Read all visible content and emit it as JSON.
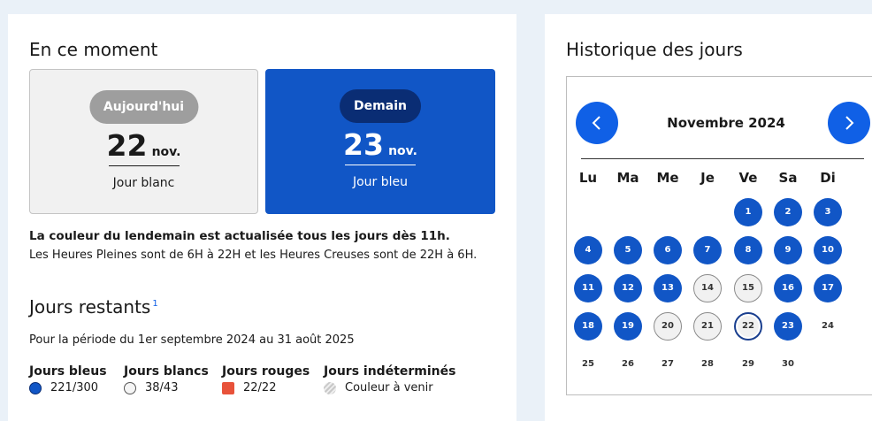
{
  "left": {
    "section_title": "En ce moment",
    "today": {
      "badge": "Aujourd'hui",
      "day": "22",
      "month": "nov.",
      "label": "Jour blanc"
    },
    "tomorrow": {
      "badge": "Demain",
      "day": "23",
      "month": "nov.",
      "label": "Jour bleu"
    },
    "update_note": "La couleur du lendemain est actualisée tous les jours dès 11h.",
    "hours_note": "Les Heures Pleines sont de 6H à 22H et les Heures Creuses sont de 22H à 6H.",
    "remaining_title": "Jours restants",
    "remaining_sup": "1",
    "period": "Pour la période du 1er septembre 2024 au 31 août 2025",
    "legend": [
      {
        "title": "Jours bleus",
        "value": "221/300",
        "swatch": "blue"
      },
      {
        "title": "Jours blancs",
        "value": "38/43",
        "swatch": "white"
      },
      {
        "title": "Jours rouges",
        "value": "22/22",
        "swatch": "red"
      },
      {
        "title": "Jours indéterminés",
        "value": "Couleur à venir",
        "swatch": "undetermined"
      }
    ]
  },
  "right": {
    "section_title": "Historique des jours",
    "calendar": {
      "month_label": "Novembre 2024",
      "prev_icon": "chevron-left-icon",
      "next_icon": "chevron-right-icon",
      "weekdays": [
        "Lu",
        "Ma",
        "Me",
        "Je",
        "Ve",
        "Sa",
        "Di"
      ],
      "first_weekday_index": 4,
      "days": [
        {
          "d": "1",
          "c": "bleu"
        },
        {
          "d": "2",
          "c": "bleu"
        },
        {
          "d": "3",
          "c": "bleu"
        },
        {
          "d": "4",
          "c": "bleu"
        },
        {
          "d": "5",
          "c": "bleu"
        },
        {
          "d": "6",
          "c": "bleu"
        },
        {
          "d": "7",
          "c": "bleu"
        },
        {
          "d": "8",
          "c": "bleu"
        },
        {
          "d": "9",
          "c": "bleu"
        },
        {
          "d": "10",
          "c": "bleu"
        },
        {
          "d": "11",
          "c": "bleu"
        },
        {
          "d": "12",
          "c": "bleu"
        },
        {
          "d": "13",
          "c": "bleu"
        },
        {
          "d": "14",
          "c": "blanc"
        },
        {
          "d": "15",
          "c": "blanc"
        },
        {
          "d": "16",
          "c": "bleu"
        },
        {
          "d": "17",
          "c": "bleu"
        },
        {
          "d": "18",
          "c": "bleu"
        },
        {
          "d": "19",
          "c": "bleu"
        },
        {
          "d": "20",
          "c": "blanc"
        },
        {
          "d": "21",
          "c": "blanc"
        },
        {
          "d": "22",
          "c": "today"
        },
        {
          "d": "23",
          "c": "bleu"
        },
        {
          "d": "24",
          "c": "none"
        },
        {
          "d": "25",
          "c": "none"
        },
        {
          "d": "26",
          "c": "none"
        },
        {
          "d": "27",
          "c": "none"
        },
        {
          "d": "28",
          "c": "none"
        },
        {
          "d": "29",
          "c": "none"
        },
        {
          "d": "30",
          "c": "none"
        }
      ]
    }
  },
  "colors": {
    "page_bg": "#eaf1f8",
    "blue_day": "#1156c6",
    "tomorrow_card": "#1156c6",
    "tomorrow_badge": "#0a2d74",
    "today_badge": "#9e9e9e",
    "red_day": "#e8523a",
    "nav_button": "#1060e6"
  }
}
